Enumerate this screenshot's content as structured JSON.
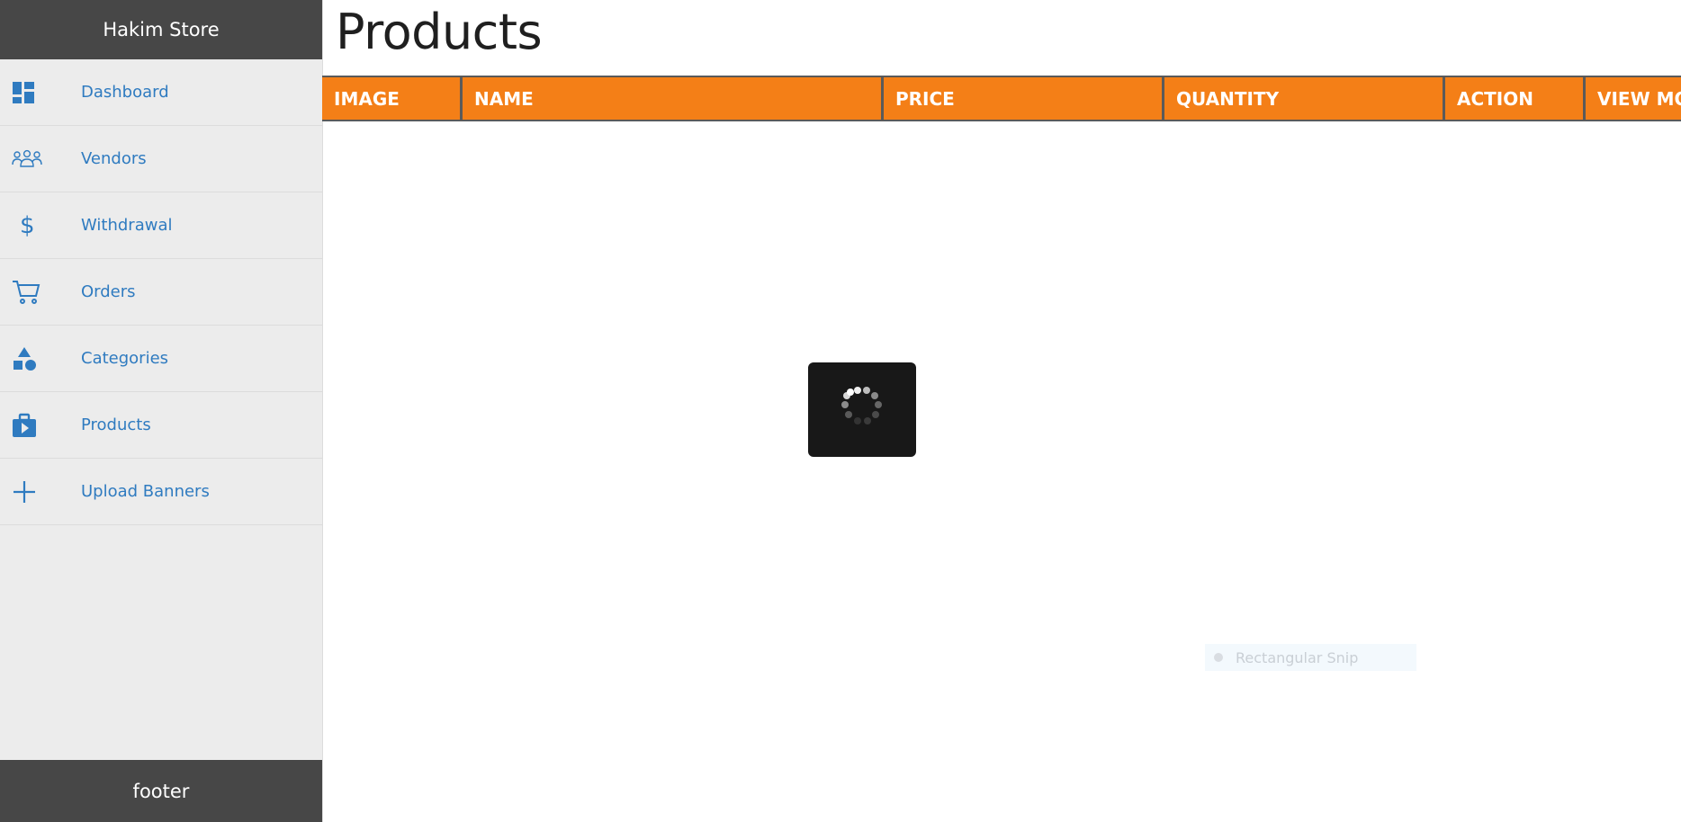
{
  "sidebar": {
    "title": "Hakim Store",
    "items": [
      {
        "label": "Dashboard",
        "icon": "dashboard-icon"
      },
      {
        "label": "Vendors",
        "icon": "vendors-icon"
      },
      {
        "label": "Withdrawal",
        "icon": "dollar-icon"
      },
      {
        "label": "Orders",
        "icon": "cart-icon"
      },
      {
        "label": "Categories",
        "icon": "shapes-icon"
      },
      {
        "label": "Products",
        "icon": "briefcase-play-icon"
      },
      {
        "label": "Upload Banners",
        "icon": "plus-icon"
      }
    ],
    "footer": "footer"
  },
  "main": {
    "title": "Products",
    "table": {
      "columns": [
        "IMAGE",
        "NAME",
        "PRICE",
        "QUANTITY",
        "ACTION",
        "VIEW MORE"
      ]
    }
  },
  "overlay": {
    "snip_label": "Rectangular Snip"
  },
  "colors": {
    "accent": "#f47f17",
    "link": "#2f7bc0",
    "sidebar_dark": "#474747",
    "sidebar_bg": "#ececec"
  }
}
